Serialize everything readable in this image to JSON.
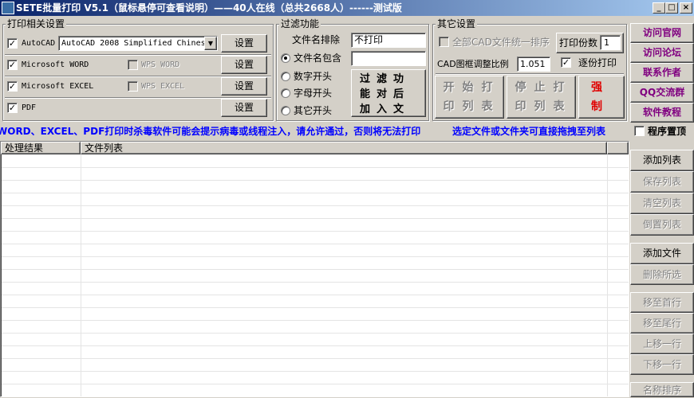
{
  "window": {
    "title": "SETE批量打印 V5.1（鼠标悬停可查看说明）——40人在线（总共2668人）------测试版",
    "min_label": "_",
    "max_label": "□",
    "close_label": "×"
  },
  "print_settings": {
    "group_label": "打印相关设置",
    "rows": [
      {
        "label": "AutoCAD",
        "checked": "✓",
        "version": "AutoCAD 2008 Simplified Chines",
        "button": "设置"
      },
      {
        "label": "Microsoft WORD",
        "checked": "✓",
        "alt_label": "WPS WORD",
        "button": "设置"
      },
      {
        "label": "Microsoft EXCEL",
        "checked": "✓",
        "alt_label": "WPS EXCEL",
        "button": "设置"
      },
      {
        "label": "PDF",
        "checked": "✓",
        "button": "设置"
      }
    ]
  },
  "filter": {
    "group_label": "过滤功能",
    "exclude_label": "文件名排除",
    "exclude_value": "不打印",
    "options": [
      "文件名包含",
      "数字开头",
      "字母开头",
      "其它开头"
    ],
    "include_value": "",
    "apply_button": "过滤功能对后加入文件有效"
  },
  "other": {
    "group_label": "其它设置",
    "all_cad_label": "全部CAD文件统一排序",
    "copies_label": "打印份数",
    "copies_value": "1",
    "ratio_label": "CAD图框调整比例",
    "ratio_value": "1.051",
    "per_copy_label": "逐份打印",
    "per_copy_checked": "✓",
    "start_button": "开始打印列表文件",
    "stop_button": "停止打印列表文件",
    "force_quit_button": "强制退出"
  },
  "side_links": [
    "访问官网",
    "访问论坛",
    "联系作者",
    "QQ交流群",
    "软件教程"
  ],
  "topmost": {
    "label": "程序置顶"
  },
  "warning": "WORD、EXCEL、PDF打印时杀毒软件可能会提示病毒或线程注入，请允许通过，否则将无法打印",
  "drag_hint": "选定文件或文件夹可直接拖拽至列表",
  "list": {
    "columns": [
      "处理结果",
      "文件列表"
    ],
    "rows": []
  },
  "list_buttons": {
    "add_list": "添加列表",
    "save_list": "保存列表",
    "clear_list": "清空列表",
    "reverse_list": "倒置列表",
    "add_file": "添加文件",
    "delete_selected": "删除所选",
    "move_top": "移至首行",
    "move_bottom": "移至尾行",
    "move_up": "上移一行",
    "move_down": "下移一行",
    "sort_name": "名称排序"
  }
}
